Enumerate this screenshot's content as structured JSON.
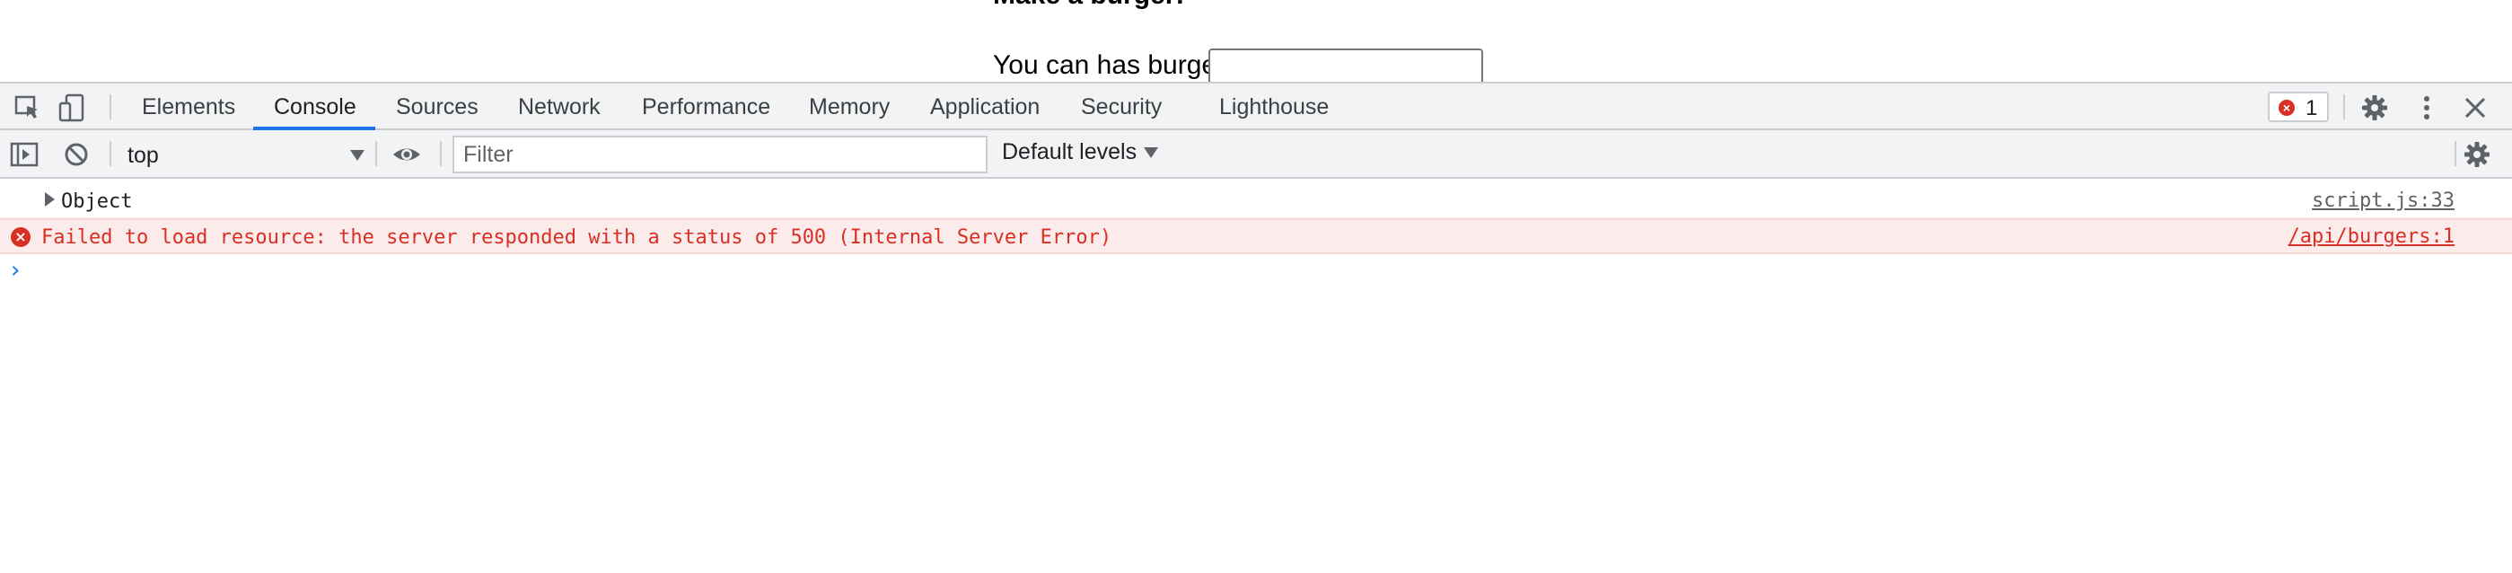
{
  "page": {
    "heading": "Make a burger!",
    "burger_label": "You can has burger:",
    "burger_value": ""
  },
  "devtools": {
    "tabs": [
      {
        "label": "Elements",
        "active": false
      },
      {
        "label": "Console",
        "active": true
      },
      {
        "label": "Sources",
        "active": false
      },
      {
        "label": "Network",
        "active": false
      },
      {
        "label": "Performance",
        "active": false
      },
      {
        "label": "Memory",
        "active": false
      },
      {
        "label": "Application",
        "active": false
      },
      {
        "label": "Security",
        "active": false
      },
      {
        "label": "Lighthouse",
        "active": false
      }
    ],
    "error_count": "1",
    "icons": {
      "inspect": "inspect-element-icon",
      "device": "device-toggle-icon",
      "settings": "gear-icon",
      "more": "kebab-menu-icon",
      "close": "close-icon",
      "sidebar": "sidebar-toggle-icon",
      "clear": "clear-console-icon",
      "eye": "eye-icon"
    },
    "toolbar": {
      "context": "top",
      "filter_placeholder": "Filter",
      "filter_value": "",
      "levels": "Default levels"
    },
    "console": {
      "object_text": "Object",
      "object_source": "script.js:33",
      "error_text": "Failed to load resource: the server responded with a status of 500 (Internal Server Error)",
      "error_source": "/api/burgers:1",
      "prompt": "›"
    },
    "colors": {
      "accent": "#1a73e8",
      "error": "#d93025",
      "error_bg": "#fcebeb",
      "toolbar_bg": "#f1f3f4"
    }
  }
}
